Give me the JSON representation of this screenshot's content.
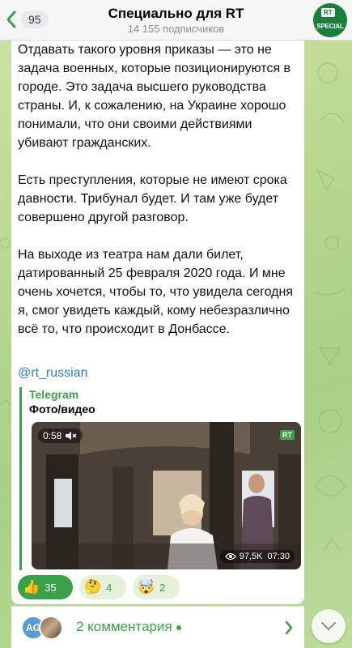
{
  "header": {
    "back_count": "95",
    "title": "Специально для RT",
    "subscribers": "14 155 подписчиков",
    "avatar_rt": "RT",
    "avatar_label": "SPECIAL"
  },
  "post": {
    "paragraphs": [
      "Отдавать такого уровня приказы — это не задача военных, которые позиционируются в городе. Это задача высшего руководства страны. И, к сожалению, на Украине хорошо понимали, что они своими действиями убивают гражданских.",
      "Есть преступления, которые не имеют срока давности. Трибунал будет. И там уже будет совершено другой разговор.",
      "На выходе из театра нам дали билет, датированный 25 февраля 2020 года. И мне очень хочется, чтобы то, что увидела сегодня я, смог увидеть каждый, кому небезразлично всё то, что происходит в Донбассе."
    ],
    "mention": "@rt_russian"
  },
  "preview": {
    "site": "Telegram",
    "title": "Фото/видео",
    "duration": "0:58",
    "badge": "RT",
    "views": "97,5K",
    "time": "07:30"
  },
  "reactions": [
    {
      "emoji": "👍",
      "count": "35",
      "active": true
    },
    {
      "emoji": "🤔",
      "count": "4",
      "active": false
    },
    {
      "emoji": "🤯",
      "count": "2",
      "active": false
    }
  ],
  "comments": {
    "avatar_initials": "AG",
    "label": "2 комментария"
  },
  "colors": {
    "accent": "#3aa14a",
    "link": "#2a7fd2",
    "brand_green": "#1a7f3b"
  },
  "icons": {
    "back": "chevron-left-icon",
    "mute": "speaker-muted-icon",
    "views": "eye-icon",
    "comments": "chevron-right-icon",
    "scroll": "chevron-down-icon"
  }
}
